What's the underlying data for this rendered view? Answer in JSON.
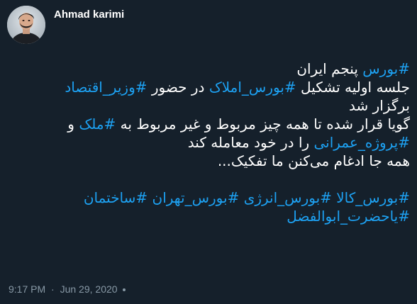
{
  "author": {
    "name": "Ahmad karimi",
    "avatar_icon": "profile-photo"
  },
  "tweet": {
    "lines": [
      [
        {
          "t": "#بورس",
          "tag": true
        },
        {
          "t": " پنجم ایران",
          "tag": false
        }
      ],
      [
        {
          "t": "جلسه اولیه تشکیل ",
          "tag": false
        },
        {
          "t": "#بورس_املاک",
          "tag": true
        },
        {
          "t": " در حضور ",
          "tag": false
        },
        {
          "t": "#وزیر_اقتصاد",
          "tag": true
        }
      ],
      [
        {
          "t": "برگزار شد",
          "tag": false
        }
      ],
      [
        {
          "t": "گویا قرار شده تا همه چیز مربوط و غیر مربوط به ",
          "tag": false
        },
        {
          "t": "#ملک",
          "tag": true
        },
        {
          "t": " و",
          "tag": false
        }
      ],
      [
        {
          "t": "#پروژه_عمرانی",
          "tag": true
        },
        {
          "t": " را در خود معامله کند",
          "tag": false
        }
      ],
      [
        {
          "t": "همه جا ادغام می‌کنن ما تفکیک...",
          "tag": false
        }
      ],
      null,
      [
        {
          "t": "#بورس_کالا",
          "tag": true
        },
        {
          "t": " ",
          "tag": false
        },
        {
          "t": "#بورس_انرژی",
          "tag": true
        },
        {
          "t": " ",
          "tag": false
        },
        {
          "t": "#بورس_تهران",
          "tag": true
        },
        {
          "t": " ",
          "tag": false
        },
        {
          "t": "#ساختمان",
          "tag": true
        }
      ],
      [
        {
          "t": "#یاحضرت_ابوالفضل",
          "tag": true
        }
      ]
    ],
    "time": "9:17 PM",
    "separator": "·",
    "date": "Jun 29, 2020"
  },
  "colors": {
    "background": "#15202b",
    "hashtag": "#1da1f2",
    "muted": "#8899a6"
  }
}
